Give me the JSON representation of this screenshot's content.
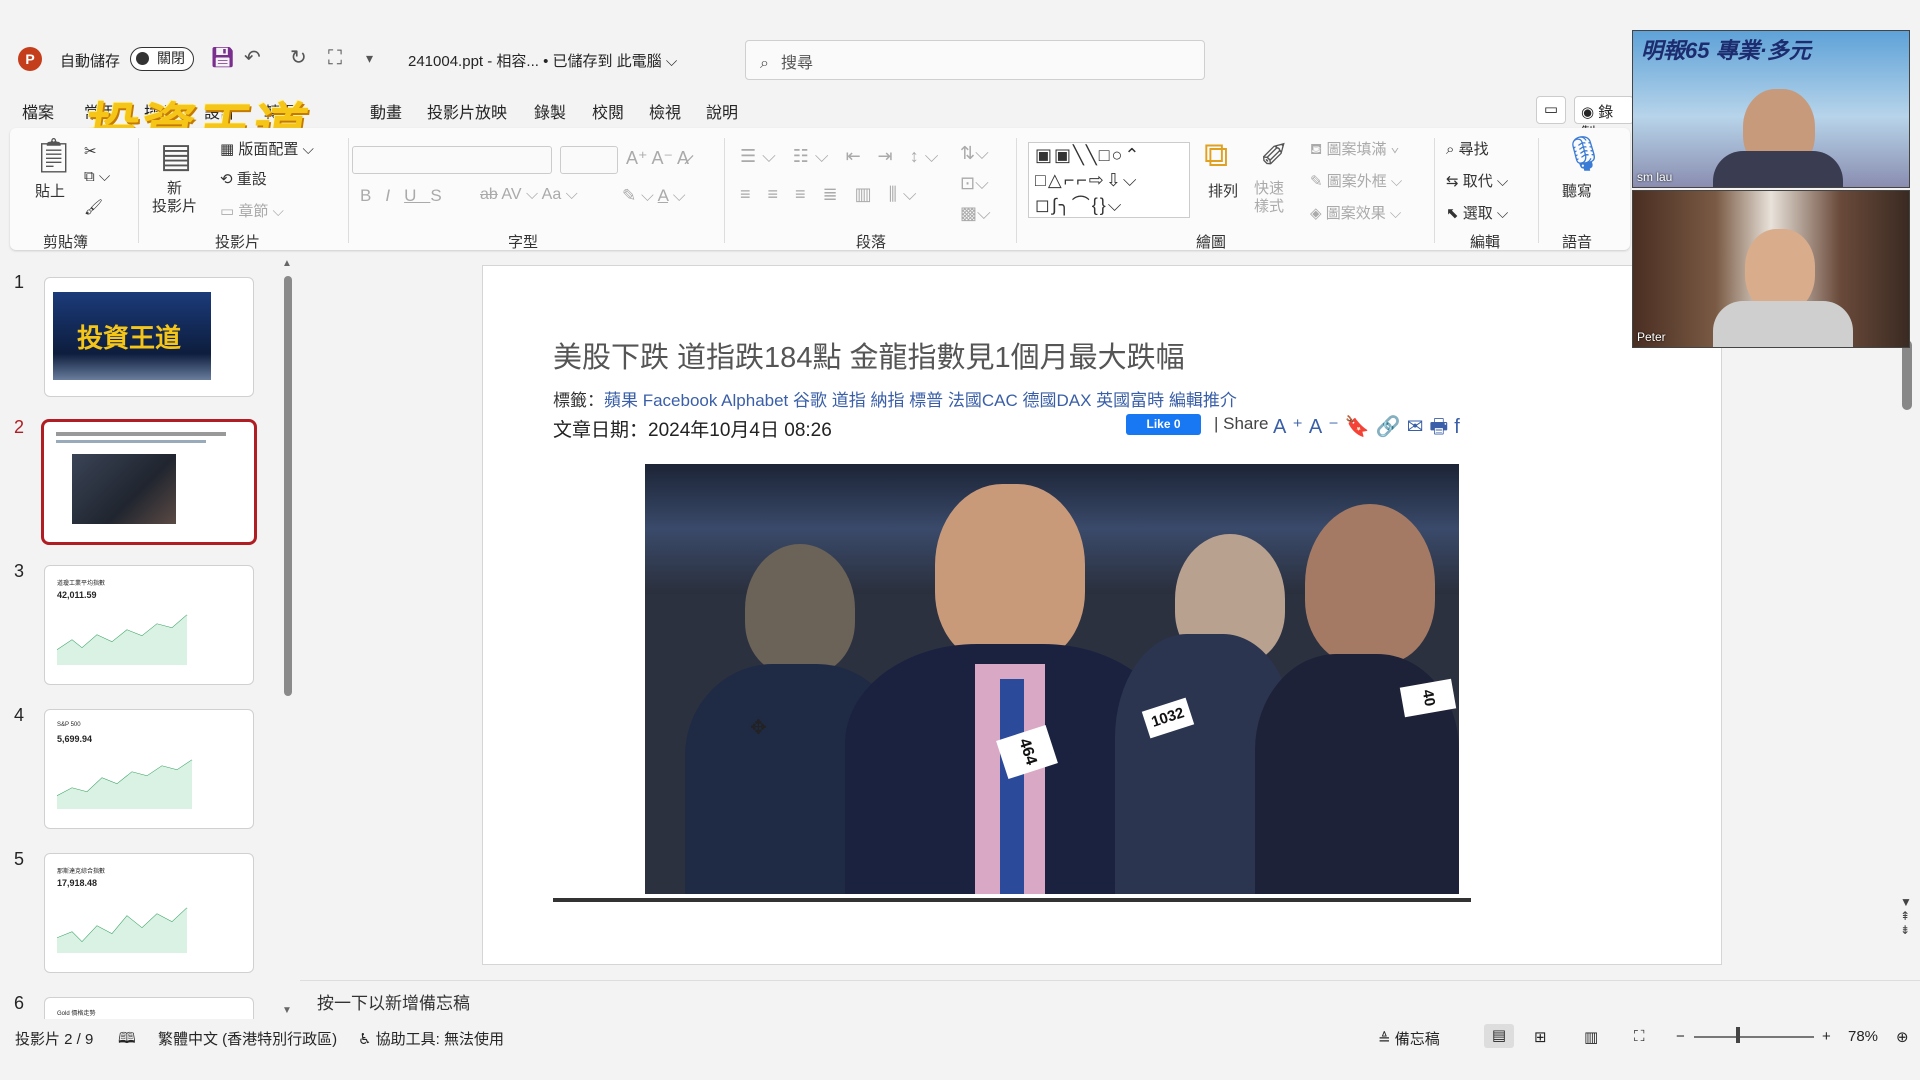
{
  "titlebar": {
    "autosave_label": "自動儲存",
    "autosave_state": "關閉",
    "doc_title": "241004.ppt  -  相容...  • 已儲存到 此電腦 ⌵",
    "search_placeholder": "搜尋"
  },
  "tabs": [
    "檔案",
    "常用",
    "插入",
    "設計",
    "轉場",
    "動畫",
    "投影片放映",
    "錄製",
    "校閱",
    "檢視",
    "說明"
  ],
  "brand_overlay": "投資王道",
  "record_label": "錄製",
  "ribbon": {
    "clipboard": {
      "paste": "貼上",
      "label": "剪貼簿"
    },
    "slides": {
      "new_slide": "新\n投影片",
      "layout": "版面配置",
      "reset": "重設",
      "section": "章節",
      "label": "投影片"
    },
    "font": {
      "label": "字型",
      "buttons": [
        "B",
        "I",
        "U",
        "S",
        "ab",
        "AV",
        "Aa"
      ]
    },
    "paragraph": {
      "label": "段落"
    },
    "drawing": {
      "arrange": "排列",
      "quick_styles": "快速樣式",
      "fill": "圖案填滿",
      "outline": "圖案外框",
      "effects": "圖案效果",
      "label": "繪圖"
    },
    "editing": {
      "find": "尋找",
      "replace": "取代",
      "select": "選取",
      "label": "編輯"
    },
    "voice": {
      "dictate": "聽寫",
      "label": "語音"
    }
  },
  "slides_panel": {
    "numbers": [
      "1",
      "2",
      "3",
      "4",
      "5",
      "6"
    ],
    "thumb3": {
      "title": "道瓊工業平均指數",
      "value": "42,011.59"
    },
    "thumb4": {
      "title": "S&P 500",
      "value": "5,699.94"
    },
    "thumb5": {
      "title": "那斯達克綜合指數",
      "value": "17,918.48"
    },
    "thumb6": {
      "title": "Gold 價格走勢"
    }
  },
  "slide": {
    "title": "美股下跌 道指跌184點 金龍指數見1個月最大跌幅",
    "tags_label": "標籤：",
    "tags": "蘋果 Facebook Alphabet 谷歌 道指 納指 標普 法國CAC 德國DAX 英國富時 編輯推介",
    "date": "文章日期：2024年10月4日 08:26",
    "fb_like": "Like 0",
    "share": "| Share",
    "share_icons": "A⁺A⁻🔖🔗✉🖶f",
    "photo_badges": [
      "464",
      "1032",
      "40"
    ]
  },
  "notes_placeholder": "按一下以新增備忘稿",
  "statusbar": {
    "slide_pos": "投影片 2 / 9",
    "language": "繁體中文 (香港特別行政區)",
    "accessibility": "協助工具: 無法使用",
    "notes_btn": "備忘稿",
    "zoom": "78%"
  },
  "video": {
    "top_name": "sm lau",
    "top_banner": "明報65 專業·多元",
    "bottom_name": "Peter"
  },
  "colors": {
    "accent": "#b01e23",
    "link": "#3a5fa8",
    "brand_gold": "#f5c518"
  }
}
